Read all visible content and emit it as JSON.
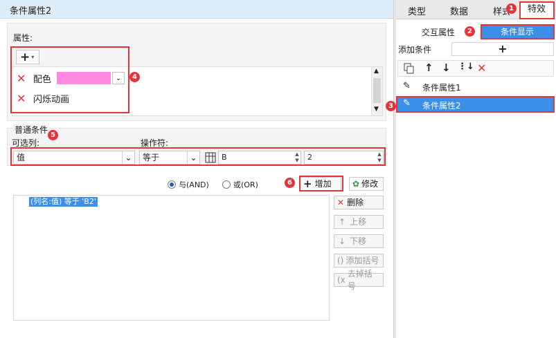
{
  "left_panel": {
    "title": "条件属性2",
    "attributes": {
      "label": "属性:",
      "items": [
        {
          "name": "配色",
          "color": "#ff88e3"
        },
        {
          "name": "闪烁动画"
        }
      ]
    },
    "normal_conditions": {
      "label": "普通条件",
      "column_label": "可选列:",
      "operator_label": "操作符:",
      "column_value": "值",
      "operator_value": "等于",
      "value_input": "B",
      "number_input": "2",
      "radio_and": "与(AND)",
      "radio_or": "或(OR)",
      "add_button": "增加",
      "modify_button": "修改",
      "delete_button": "删除",
      "up_button": "上移",
      "down_button": "下移",
      "add_bracket_button": "添加括号",
      "remove_bracket_button": "去掉括号",
      "condition_items": [
        "(列名:值) 等于 'B2'"
      ]
    }
  },
  "right_panel": {
    "tabs": [
      "类型",
      "数据",
      "样式",
      "特效"
    ],
    "subtabs": [
      "交互属性",
      "条件显示"
    ],
    "add_condition_label": "添加条件",
    "add_condition_plus": "+",
    "conditions": [
      {
        "name": "条件属性1",
        "selected": false
      },
      {
        "name": "条件属性2",
        "selected": true
      }
    ]
  },
  "annotations": [
    "1",
    "2",
    "3",
    "4",
    "5",
    "6"
  ],
  "colors": {
    "accent_blue": "#3c8fe8",
    "annotation_red": "#e5333a",
    "header_bg": "#dcecf8"
  }
}
